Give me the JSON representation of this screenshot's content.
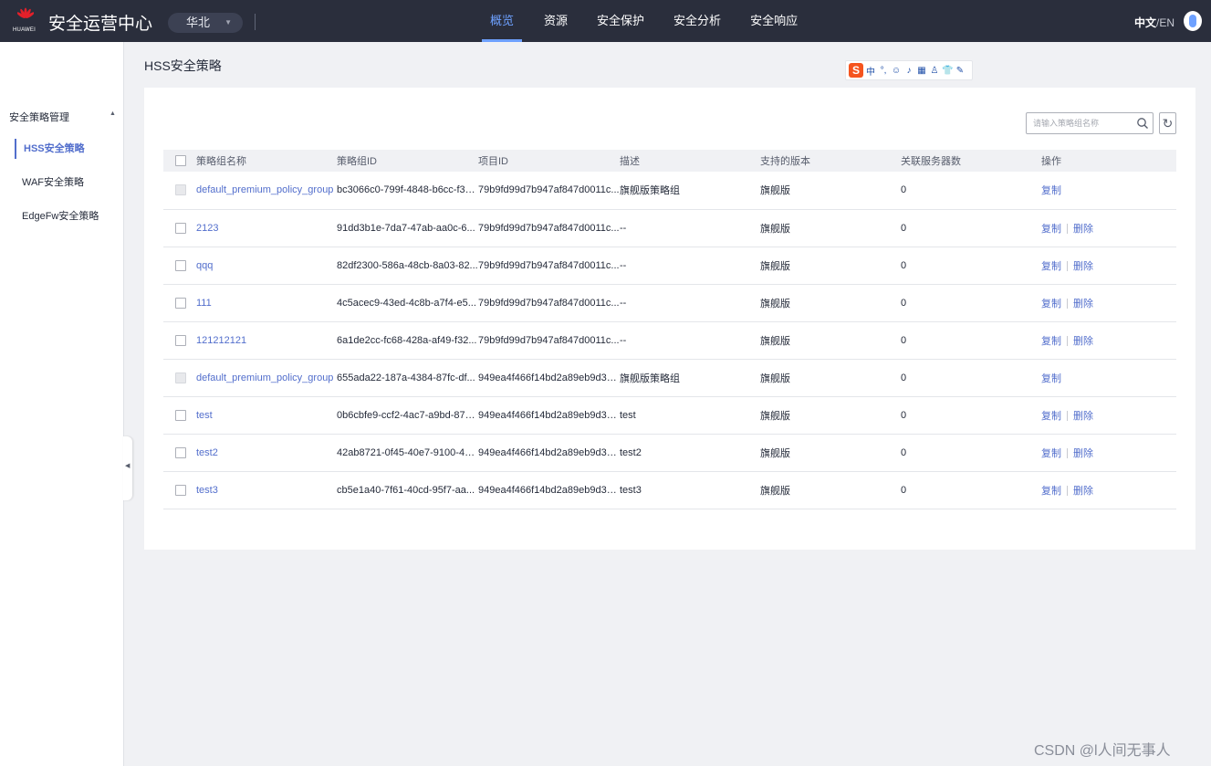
{
  "header": {
    "brand_small": "HUAWEI",
    "app_title": "安全运营中心",
    "region": "华北",
    "nav": [
      "概览",
      "资源",
      "安全保护",
      "安全分析",
      "安全响应"
    ],
    "active_nav_index": 0,
    "lang_current": "中文",
    "lang_sep": "/",
    "lang_other": "EN"
  },
  "sidebar": {
    "group_label": "安全策略管理",
    "items": [
      {
        "label": "HSS安全策略",
        "active": true
      },
      {
        "label": "WAF安全策略",
        "active": false
      },
      {
        "label": "EdgeFw安全策略",
        "active": false
      }
    ]
  },
  "page": {
    "title": "HSS安全策略"
  },
  "toolbar": {
    "search_placeholder": "请输入策略组名称",
    "refresh_icon": "↻"
  },
  "ime": {
    "logo": "S",
    "symbols": [
      "中",
      "°,",
      "☺",
      "♪",
      "▦",
      "♙",
      "👕",
      "✎"
    ]
  },
  "table": {
    "columns": [
      "策略组名称",
      "策略组ID",
      "项目ID",
      "描述",
      "支持的版本",
      "关联服务器数",
      "操作"
    ],
    "rows": [
      {
        "name": "default_premium_policy_group",
        "id": "bc3066c0-799f-4848-b6cc-f38...",
        "project": "79b9fd99d7b947af847d0011c...",
        "desc": "旗舰版策略组",
        "version": "旗舰版",
        "servers": "0",
        "ops": [
          "复制"
        ],
        "disabled": true
      },
      {
        "name": "2123",
        "id": "91dd3b1e-7da7-47ab-aa0c-6...",
        "project": "79b9fd99d7b947af847d0011c...",
        "desc": "--",
        "version": "旗舰版",
        "servers": "0",
        "ops": [
          "复制",
          "删除"
        ],
        "disabled": false
      },
      {
        "name": "qqq",
        "id": "82df2300-586a-48cb-8a03-82...",
        "project": "79b9fd99d7b947af847d0011c...",
        "desc": "--",
        "version": "旗舰版",
        "servers": "0",
        "ops": [
          "复制",
          "删除"
        ],
        "disabled": false
      },
      {
        "name": "111",
        "id": "4c5acec9-43ed-4c8b-a7f4-e5...",
        "project": "79b9fd99d7b947af847d0011c...",
        "desc": "--",
        "version": "旗舰版",
        "servers": "0",
        "ops": [
          "复制",
          "删除"
        ],
        "disabled": false
      },
      {
        "name": "121212121",
        "id": "6a1de2cc-fc68-428a-af49-f32...",
        "project": "79b9fd99d7b947af847d0011c...",
        "desc": "--",
        "version": "旗舰版",
        "servers": "0",
        "ops": [
          "复制",
          "删除"
        ],
        "disabled": false
      },
      {
        "name": "default_premium_policy_group",
        "id": "655ada22-187a-4384-87fc-df...",
        "project": "949ea4f466f14bd2a89eb9d3c...",
        "desc": "旗舰版策略组",
        "version": "旗舰版",
        "servers": "0",
        "ops": [
          "复制"
        ],
        "disabled": true
      },
      {
        "name": "test",
        "id": "0b6cbfe9-ccf2-4ac7-a9bd-879...",
        "project": "949ea4f466f14bd2a89eb9d3c...",
        "desc": "test",
        "version": "旗舰版",
        "servers": "0",
        "ops": [
          "复制",
          "删除"
        ],
        "disabled": false
      },
      {
        "name": "test2",
        "id": "42ab8721-0f45-40e7-9100-4b...",
        "project": "949ea4f466f14bd2a89eb9d3c...",
        "desc": "test2",
        "version": "旗舰版",
        "servers": "0",
        "ops": [
          "复制",
          "删除"
        ],
        "disabled": false
      },
      {
        "name": "test3",
        "id": "cb5e1a40-7f61-40cd-95f7-aa...",
        "project": "949ea4f466f14bd2a89eb9d3c...",
        "desc": "test3",
        "version": "旗舰版",
        "servers": "0",
        "ops": [
          "复制",
          "删除"
        ],
        "disabled": false
      }
    ]
  },
  "watermark": "CSDN @l人间无事人",
  "colors": {
    "topbar": "#2a2e3c",
    "accent": "#526ecc",
    "nav_active": "#6ea1ff",
    "logo_red": "#e3202a"
  }
}
